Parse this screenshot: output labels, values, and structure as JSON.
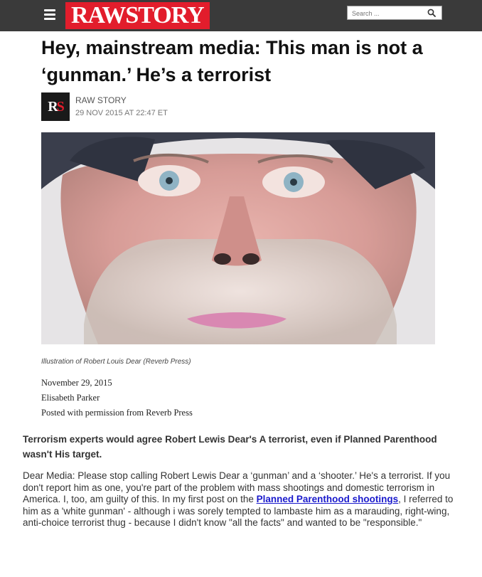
{
  "header": {
    "logo_text": "RAWSTORY",
    "search_placeholder": "Search ...",
    "brand_color": "#e21d2c"
  },
  "article": {
    "headline": "Hey, mainstream media: This man is not a ‘gunman.’ He’s a terrorist",
    "author_logo": "RS",
    "author_name": "RAW STORY",
    "date": "29 NOV 2015 AT 22:47 ET",
    "image_caption": "Illustration of Robert Louis Dear (Reverb Press)",
    "meta_date": "November 29, 2015",
    "meta_author": "Elisabeth Parker",
    "meta_permission": "Posted with permission from Reverb Press",
    "lead": "Terrorism experts would agree Robert Lewis Dear's A terrorist, even if Planned Parenthood wasn't His target.",
    "body_before_link": "Dear Media: Please stop calling Robert Lewis Dear a ‘gunman’ and a ‘shooter.’ He's a terrorist. If you don't report him as one, you're part of the problem with mass shootings and domestic terrorism in America. I, too, am guilty of this. In my first post on the ",
    "body_link": "Planned Parenthood shootings",
    "body_after_link": ", I referred to him as a 'white gunman' - although i was sorely tempted to lambaste him as a marauding, right-wing, anti-choice terrorist thug - because I didn't know \"all the facts\" and wanted to be \"responsible.\""
  }
}
